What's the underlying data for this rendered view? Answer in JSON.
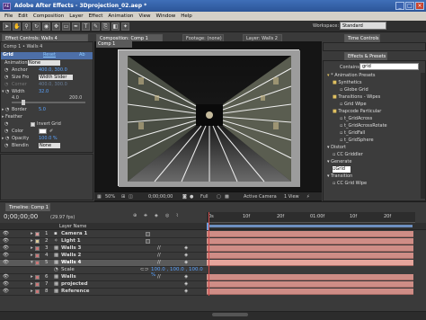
{
  "window": {
    "title": "Adobe After Effects - 3Dprojection_02.aep *",
    "app_icon": "AE",
    "minimize": "_",
    "maximize": "□",
    "close": "×"
  },
  "menu": [
    "File",
    "Edit",
    "Composition",
    "Layer",
    "Effect",
    "Animation",
    "View",
    "Window",
    "Help"
  ],
  "toolbar": {
    "tools": [
      "arrow-icon",
      "hand-icon",
      "zoom-icon",
      "rotate-icon",
      "camera-icon",
      "pan-behind-icon",
      "rectangle-icon",
      "pen-icon",
      "text-icon",
      "brush-icon",
      "clone-icon",
      "eraser-icon",
      "puppet-icon"
    ],
    "workspace_label": "Workspace:",
    "workspace_value": "Standard"
  },
  "effect_controls": {
    "tab_label": "Effect Controls: Walls 4",
    "breadcrumb": "Comp 1 • Walls 4",
    "effect_name": "Grid",
    "reset_label": "Reset",
    "about_label": "Ab",
    "properties": [
      {
        "label": "Animation",
        "value": "None",
        "kind": "dropdown"
      },
      {
        "label": "Anchor",
        "value": "400.0, 300.0",
        "kind": "value"
      },
      {
        "label": "Size Fro",
        "value": "Width Slider",
        "kind": "dropdown"
      },
      {
        "label": "Corner",
        "value": "400.0, 300.0",
        "kind": "value"
      },
      {
        "label": "Width",
        "value": "32.0",
        "kind": "value"
      },
      {
        "label": "Border",
        "value": "5.0",
        "kind": "value"
      },
      {
        "label": "Feather",
        "value": "",
        "kind": "group"
      },
      {
        "label": "Invert Grid",
        "value": "",
        "kind": "checkbox"
      },
      {
        "label": "Color",
        "value": "",
        "kind": "color"
      },
      {
        "label": "Opacity",
        "value": "100.0 %",
        "kind": "value"
      },
      {
        "label": "Blendin",
        "value": "None",
        "kind": "dropdown"
      }
    ],
    "slider_min": "4.0",
    "slider_max": "200.0"
  },
  "composition": {
    "tabs": [
      "Composition: Comp 1",
      "Footage: (none)",
      "Layer: Walls 2"
    ],
    "breadcrumb": "Comp 1",
    "zoom": "50%",
    "timecode": "0;00;00;00",
    "resolution": "Full",
    "camera": "Active Camera",
    "views": "1 View"
  },
  "time_controls": {
    "tab_label": "Time Controls"
  },
  "effects_presets": {
    "tab_label": "Effects & Presets",
    "contains_label": "Contains:",
    "search_value": "grid",
    "items": [
      {
        "label": "* Animation Presets",
        "level": 0
      },
      {
        "label": "Synthetics",
        "level": 1
      },
      {
        "label": "Globe Grid",
        "level": 2
      },
      {
        "label": "Transitions - Wipes",
        "level": 1
      },
      {
        "label": "Grid Wipe",
        "level": 2
      },
      {
        "label": "Trapcode Particular",
        "level": 1
      },
      {
        "label": "t_GridAcross",
        "level": 2
      },
      {
        "label": "t_GridAcrossRotate",
        "level": 2
      },
      {
        "label": "t_GridFall",
        "level": 2
      },
      {
        "label": "t_GridSphere",
        "level": 2
      },
      {
        "label": "Distort",
        "level": 0
      },
      {
        "label": "CC Griddler",
        "level": 1
      },
      {
        "label": "Generate",
        "level": 0
      },
      {
        "label": "Grid",
        "level": 1
      },
      {
        "label": "Transition",
        "level": 0
      },
      {
        "label": "CC Grid Wipe",
        "level": 1
      }
    ]
  },
  "timeline": {
    "tab_label": "Timeline: Comp 1",
    "timecode": "0;00;00;00",
    "fps": "(29.97 fps)",
    "column_header": "Layer Name",
    "ruler_labels": [
      "0s",
      "10f",
      "20f",
      "01:00f",
      "10f",
      "20f"
    ],
    "layers": [
      {
        "num": "1",
        "name": "Camera 1"
      },
      {
        "num": "2",
        "name": "Light 1"
      },
      {
        "num": "3",
        "name": "Walls 3"
      },
      {
        "num": "4",
        "name": "Walls 2"
      },
      {
        "num": "5",
        "name": "Walls 4"
      },
      {
        "num": "",
        "name": "Scale",
        "value": "100.0 , 100.0 , 100.0 %"
      },
      {
        "num": "6",
        "name": "Walls"
      },
      {
        "num": "7",
        "name": "projected"
      },
      {
        "num": "8",
        "name": "Reference"
      }
    ]
  }
}
